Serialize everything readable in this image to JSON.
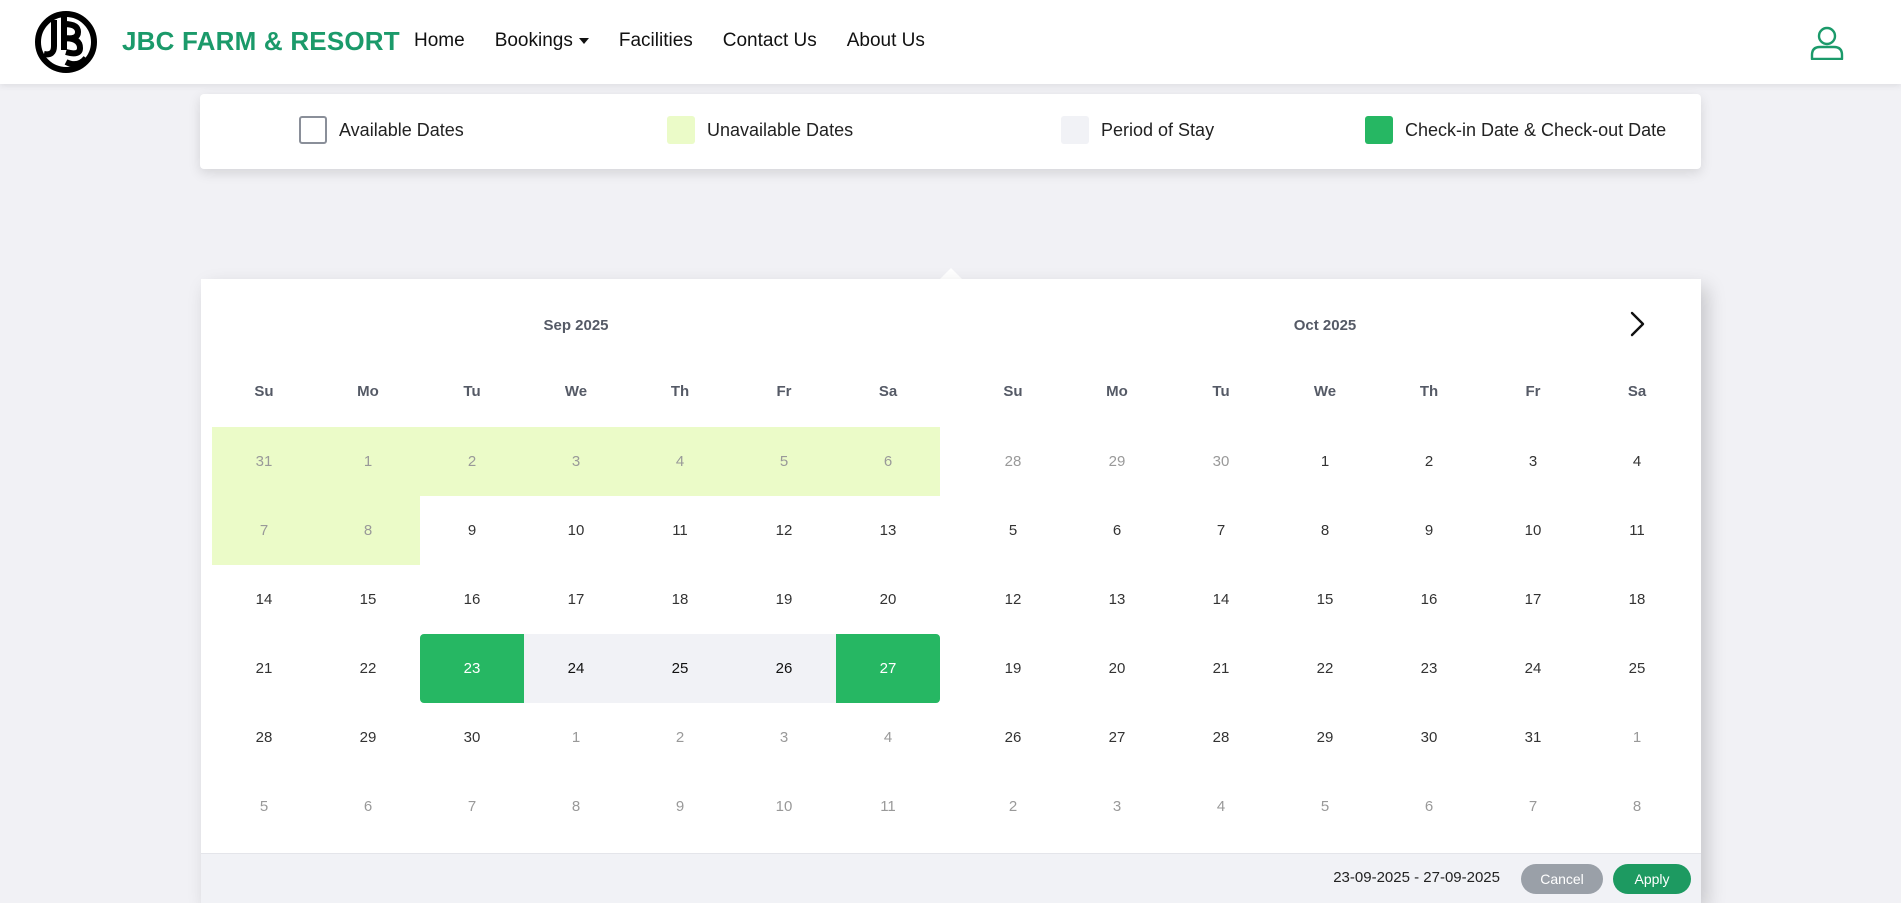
{
  "brand": {
    "name": "JBC FARM & RESORT",
    "logo_text": "JBC"
  },
  "nav": {
    "home": "Home",
    "bookings": "Bookings",
    "facilities": "Facilities",
    "contact": "Contact Us",
    "about": "About Us"
  },
  "icons": {
    "user": "user-icon",
    "logo": "jbc-logo-icon",
    "next": "chevron-right-icon"
  },
  "legend": {
    "available": "Available Dates",
    "unavailable": "Unavailable Dates",
    "period": "Period of Stay",
    "checkin_checkout": "Check-in Date & Check-out Date"
  },
  "colors": {
    "brand_green": "#1b9a6a",
    "unavailable": "#ebfbc8",
    "period": "#f1f2f6",
    "selected": "#26b763",
    "apply": "#1d9a61",
    "cancel": "#9aa0a8"
  },
  "calendar": {
    "weekdays": [
      "Su",
      "Mo",
      "Tu",
      "We",
      "Th",
      "Fr",
      "Sa"
    ],
    "months": [
      {
        "title": "Sep 2025",
        "weeks": [
          [
            {
              "d": "31",
              "s": "unavail"
            },
            {
              "d": "1",
              "s": "unavail"
            },
            {
              "d": "2",
              "s": "unavail"
            },
            {
              "d": "3",
              "s": "unavail"
            },
            {
              "d": "4",
              "s": "unavail"
            },
            {
              "d": "5",
              "s": "unavail"
            },
            {
              "d": "6",
              "s": "unavail"
            }
          ],
          [
            {
              "d": "7",
              "s": "unavail"
            },
            {
              "d": "8",
              "s": "unavail"
            },
            {
              "d": "9",
              "s": ""
            },
            {
              "d": "10",
              "s": ""
            },
            {
              "d": "11",
              "s": ""
            },
            {
              "d": "12",
              "s": ""
            },
            {
              "d": "13",
              "s": ""
            }
          ],
          [
            {
              "d": "14",
              "s": ""
            },
            {
              "d": "15",
              "s": ""
            },
            {
              "d": "16",
              "s": ""
            },
            {
              "d": "17",
              "s": ""
            },
            {
              "d": "18",
              "s": ""
            },
            {
              "d": "19",
              "s": ""
            },
            {
              "d": "20",
              "s": ""
            }
          ],
          [
            {
              "d": "21",
              "s": ""
            },
            {
              "d": "22",
              "s": ""
            },
            {
              "d": "23",
              "s": "start"
            },
            {
              "d": "24",
              "s": "range"
            },
            {
              "d": "25",
              "s": "range"
            },
            {
              "d": "26",
              "s": "range"
            },
            {
              "d": "27",
              "s": "end"
            }
          ],
          [
            {
              "d": "28",
              "s": ""
            },
            {
              "d": "29",
              "s": ""
            },
            {
              "d": "30",
              "s": ""
            },
            {
              "d": "1",
              "s": "off"
            },
            {
              "d": "2",
              "s": "off"
            },
            {
              "d": "3",
              "s": "off"
            },
            {
              "d": "4",
              "s": "off"
            }
          ],
          [
            {
              "d": "5",
              "s": "off"
            },
            {
              "d": "6",
              "s": "off"
            },
            {
              "d": "7",
              "s": "off"
            },
            {
              "d": "8",
              "s": "off"
            },
            {
              "d": "9",
              "s": "off"
            },
            {
              "d": "10",
              "s": "off"
            },
            {
              "d": "11",
              "s": "off"
            }
          ]
        ]
      },
      {
        "title": "Oct 2025",
        "weeks": [
          [
            {
              "d": "28",
              "s": "off"
            },
            {
              "d": "29",
              "s": "off"
            },
            {
              "d": "30",
              "s": "off"
            },
            {
              "d": "1",
              "s": ""
            },
            {
              "d": "2",
              "s": ""
            },
            {
              "d": "3",
              "s": ""
            },
            {
              "d": "4",
              "s": ""
            }
          ],
          [
            {
              "d": "5",
              "s": ""
            },
            {
              "d": "6",
              "s": ""
            },
            {
              "d": "7",
              "s": ""
            },
            {
              "d": "8",
              "s": ""
            },
            {
              "d": "9",
              "s": ""
            },
            {
              "d": "10",
              "s": ""
            },
            {
              "d": "11",
              "s": ""
            }
          ],
          [
            {
              "d": "12",
              "s": ""
            },
            {
              "d": "13",
              "s": ""
            },
            {
              "d": "14",
              "s": ""
            },
            {
              "d": "15",
              "s": ""
            },
            {
              "d": "16",
              "s": ""
            },
            {
              "d": "17",
              "s": ""
            },
            {
              "d": "18",
              "s": ""
            }
          ],
          [
            {
              "d": "19",
              "s": ""
            },
            {
              "d": "20",
              "s": ""
            },
            {
              "d": "21",
              "s": ""
            },
            {
              "d": "22",
              "s": ""
            },
            {
              "d": "23",
              "s": ""
            },
            {
              "d": "24",
              "s": ""
            },
            {
              "d": "25",
              "s": ""
            }
          ],
          [
            {
              "d": "26",
              "s": ""
            },
            {
              "d": "27",
              "s": ""
            },
            {
              "d": "28",
              "s": ""
            },
            {
              "d": "29",
              "s": ""
            },
            {
              "d": "30",
              "s": ""
            },
            {
              "d": "31",
              "s": ""
            },
            {
              "d": "1",
              "s": "off"
            }
          ],
          [
            {
              "d": "2",
              "s": "off"
            },
            {
              "d": "3",
              "s": "off"
            },
            {
              "d": "4",
              "s": "off"
            },
            {
              "d": "5",
              "s": "off"
            },
            {
              "d": "6",
              "s": "off"
            },
            {
              "d": "7",
              "s": "off"
            },
            {
              "d": "8",
              "s": "off"
            }
          ]
        ]
      }
    ],
    "selected_range": "23-09-2025 - 27-09-2025",
    "cancel_label": "Cancel",
    "apply_label": "Apply"
  }
}
